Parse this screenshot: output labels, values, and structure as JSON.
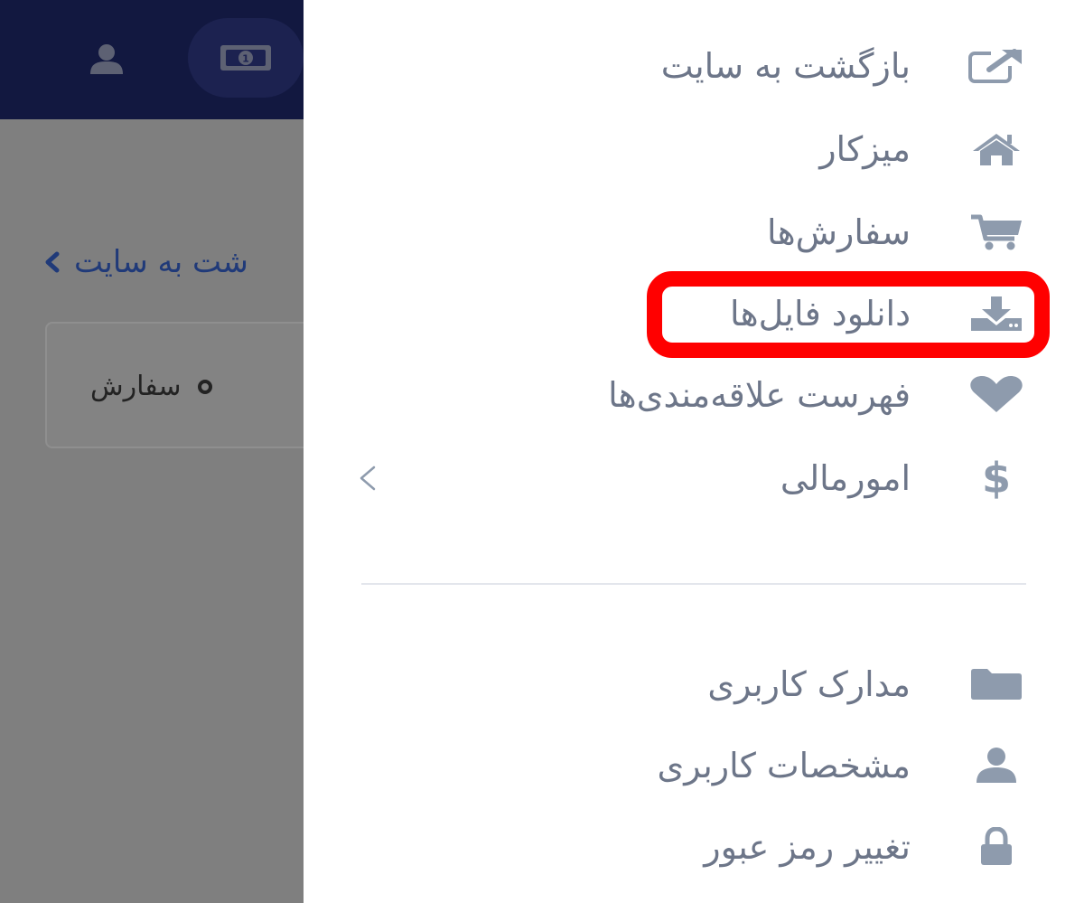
{
  "background": {
    "breadcrumb_text": "شت به سایت",
    "card_item_label": "سفارش"
  },
  "drawer": {
    "items": [
      {
        "label": "بازگشت به سایت",
        "icon": "external-link-icon"
      },
      {
        "label": "میزکار",
        "icon": "home-icon"
      },
      {
        "label": "سفارش‌ها",
        "icon": "cart-icon"
      },
      {
        "label": "دانلود فایل‌ها",
        "icon": "download-icon",
        "highlighted": true
      },
      {
        "label": "فهرست علاقه‌مندی‌ها",
        "icon": "heart-icon"
      },
      {
        "label": "امورمالی",
        "icon": "dollar-icon",
        "expandable": true
      },
      {
        "label": "مدارک کاربری",
        "icon": "folder-icon"
      },
      {
        "label": "مشخصات کاربری",
        "icon": "user-icon"
      },
      {
        "label": "تغییر رمز عبور",
        "icon": "lock-icon"
      }
    ]
  },
  "colors": {
    "header": "#121840",
    "highlight": "#ff0000",
    "icon": "#8e9bad",
    "text": "#6d7689"
  }
}
